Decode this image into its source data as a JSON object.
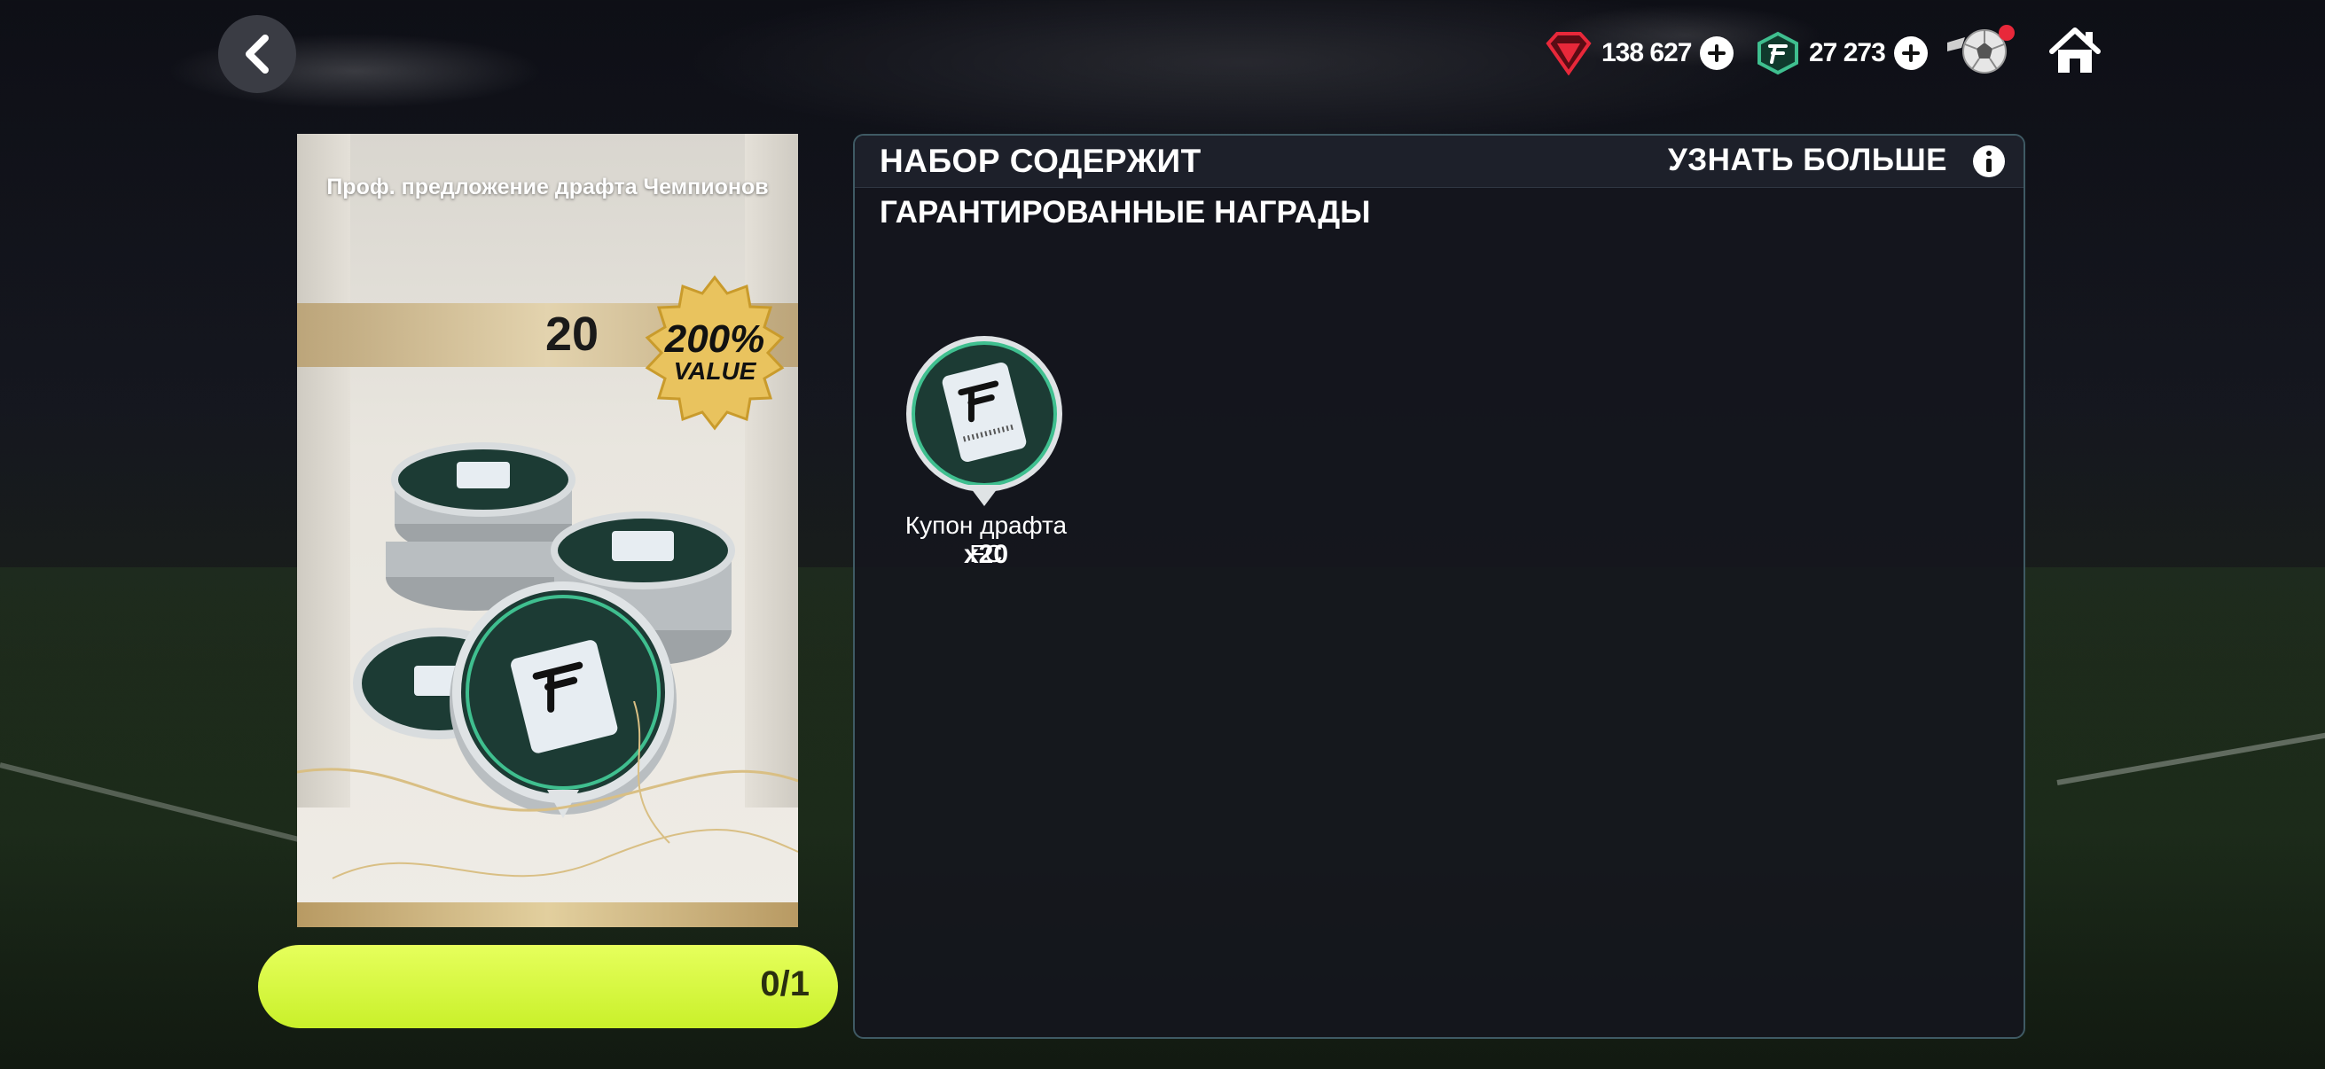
{
  "header": {
    "back_icon": "chevron-left-icon",
    "currencies": [
      {
        "icon": "red-gem-icon",
        "amount": "138 627",
        "color": "#e8283a"
      },
      {
        "icon": "fc-points-icon",
        "amount": "27 273",
        "color": "#3fbf8f"
      }
    ],
    "ball_icon": "soccer-ball-icon",
    "home_icon": "home-icon"
  },
  "offer": {
    "title": "Проф. предложение драфта Чемпионов",
    "quantity": "20",
    "badge_percent": "200%",
    "badge_word": "VALUE",
    "progress_text": "0/1",
    "progress_fraction": 0
  },
  "panel": {
    "title": "НАБОР СОДЕРЖИТ",
    "learn_more": "УЗНАТЬ БОЛЬШЕ",
    "section_label": "ГАРАНТИРОВАННЫЕ НАГРАДЫ",
    "rewards": [
      {
        "name": "Купон драфта FC",
        "qty": "x20",
        "icon": "draft-ticket-icon"
      }
    ]
  }
}
